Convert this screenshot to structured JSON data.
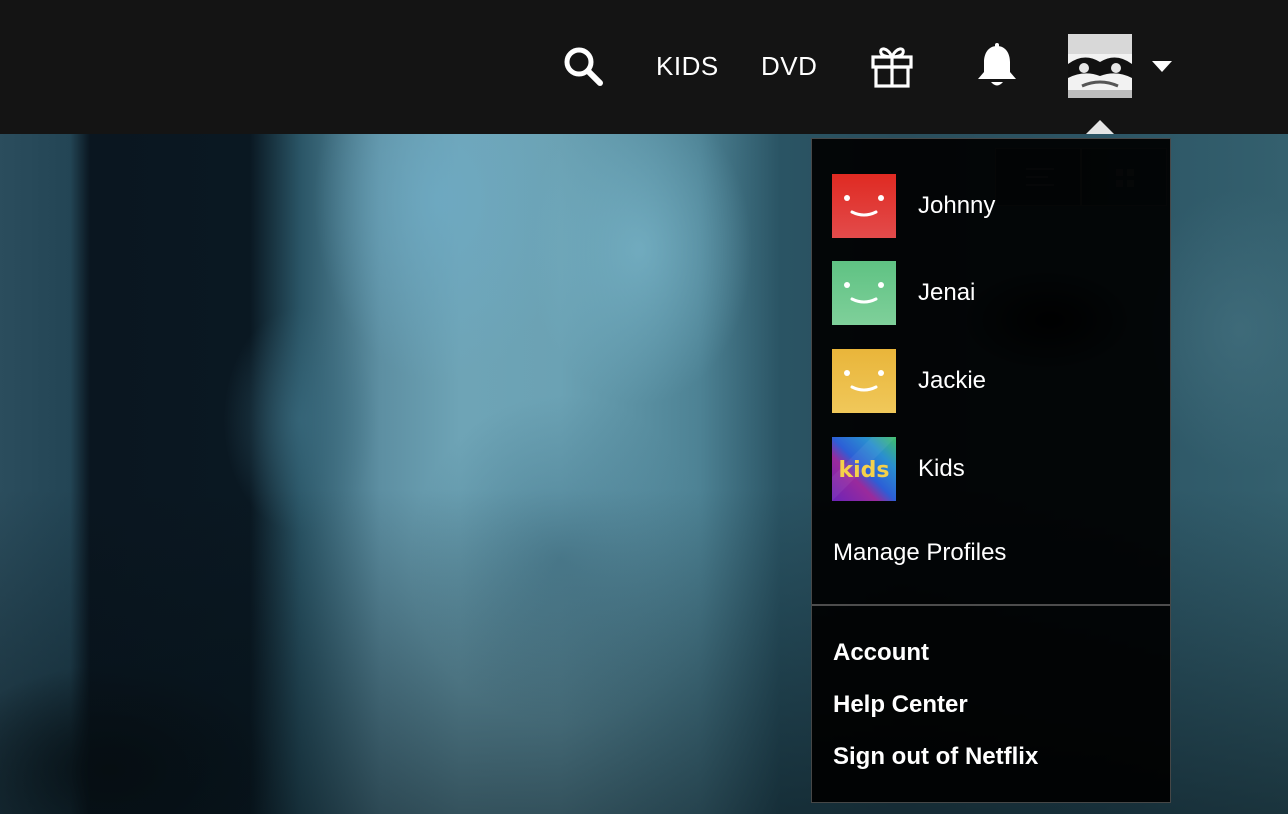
{
  "header": {
    "nav_links": {
      "kids": "KIDS",
      "dvd": "DVD"
    },
    "icons": {
      "search": "search-icon",
      "gift": "gift-icon",
      "notifications": "bell-icon",
      "caret": "caret-down-icon"
    },
    "colors": {
      "background": "#141414",
      "text": "#ffffff"
    }
  },
  "account_menu": {
    "profiles": [
      {
        "name": "Johnny",
        "avatar_color": "#e0322d"
      },
      {
        "name": "Jenai",
        "avatar_color": "#6dc98a"
      },
      {
        "name": "Jackie",
        "avatar_color": "#eec04a"
      },
      {
        "name": "Kids",
        "avatar_text": "kids"
      }
    ],
    "manage_profiles": "Manage Profiles",
    "links": {
      "account": "Account",
      "help_center": "Help Center",
      "sign_out": "Sign out of Netflix"
    }
  }
}
